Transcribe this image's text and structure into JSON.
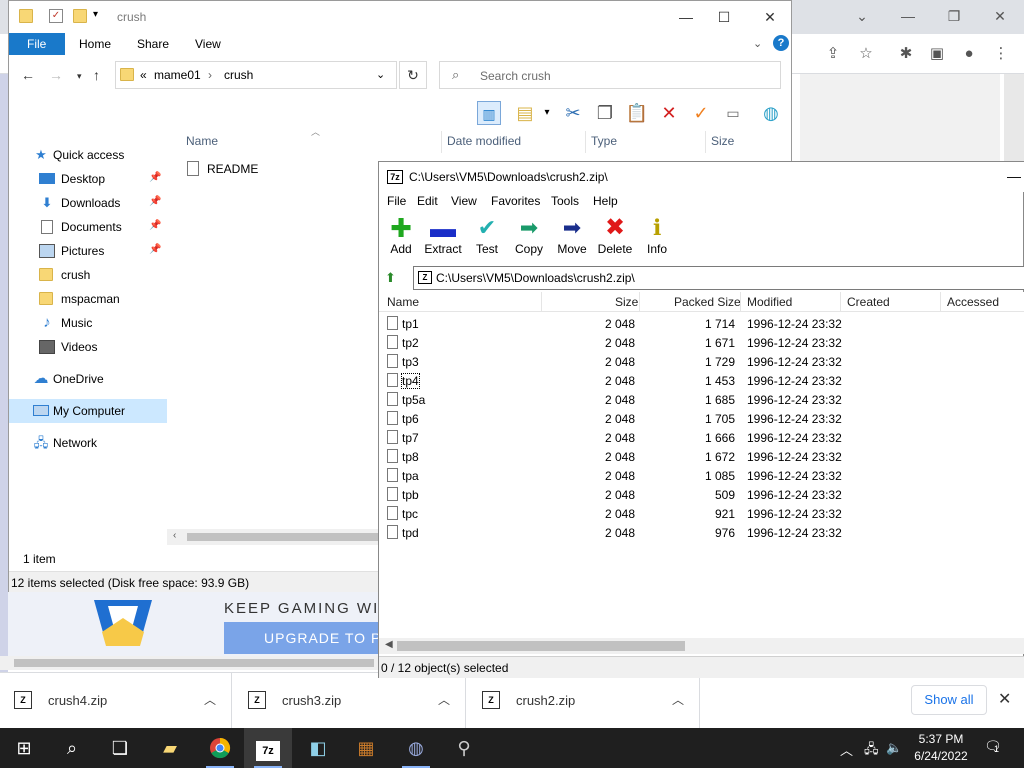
{
  "explorer": {
    "title": "crush",
    "ribbon_tabs": [
      "File",
      "Home",
      "Share",
      "View"
    ],
    "breadcrumb": [
      "mame01",
      "crush"
    ],
    "breadcrumb_prefix": "«",
    "search_placeholder": "Search crush",
    "nav": {
      "quick_access": "Quick access",
      "items": [
        {
          "label": "Desktop",
          "pinned": true
        },
        {
          "label": "Downloads",
          "pinned": true
        },
        {
          "label": "Documents",
          "pinned": true
        },
        {
          "label": "Pictures",
          "pinned": true
        },
        {
          "label": "crush",
          "pinned": false
        },
        {
          "label": "mspacman",
          "pinned": false
        },
        {
          "label": "Music",
          "pinned": false
        },
        {
          "label": "Videos",
          "pinned": false
        }
      ],
      "onedrive": "OneDrive",
      "my_computer": "My Computer",
      "network": "Network"
    },
    "columns": [
      "Name",
      "Date modified",
      "Type",
      "Size"
    ],
    "files": [
      "README"
    ],
    "item_count": "1 item",
    "status": "12 items selected (Disk free space: 93.9 GB)"
  },
  "sevenzip": {
    "title": "C:\\Users\\VM5\\Downloads\\crush2.zip\\",
    "menu": [
      "File",
      "Edit",
      "View",
      "Favorites",
      "Tools",
      "Help"
    ],
    "tools": [
      "Add",
      "Extract",
      "Test",
      "Copy",
      "Move",
      "Delete",
      "Info"
    ],
    "address": "C:\\Users\\VM5\\Downloads\\crush2.zip\\",
    "columns": [
      "Name",
      "Size",
      "Packed Size",
      "Modified",
      "Created",
      "Accessed"
    ],
    "rows": [
      {
        "name": "tp1",
        "size": "2 048",
        "packed": "1 714",
        "modified": "1996-12-24 23:32"
      },
      {
        "name": "tp2",
        "size": "2 048",
        "packed": "1 671",
        "modified": "1996-12-24 23:32"
      },
      {
        "name": "tp3",
        "size": "2 048",
        "packed": "1 729",
        "modified": "1996-12-24 23:32"
      },
      {
        "name": "tp4",
        "size": "2 048",
        "packed": "1 453",
        "modified": "1996-12-24 23:32"
      },
      {
        "name": "tp5a",
        "size": "2 048",
        "packed": "1 685",
        "modified": "1996-12-24 23:32"
      },
      {
        "name": "tp6",
        "size": "2 048",
        "packed": "1 705",
        "modified": "1996-12-24 23:32"
      },
      {
        "name": "tp7",
        "size": "2 048",
        "packed": "1 666",
        "modified": "1996-12-24 23:32"
      },
      {
        "name": "tp8",
        "size": "2 048",
        "packed": "1 672",
        "modified": "1996-12-24 23:32"
      },
      {
        "name": "tpa",
        "size": "2 048",
        "packed": "1 085",
        "modified": "1996-12-24 23:32"
      },
      {
        "name": "tpb",
        "size": "2 048",
        "packed": "509",
        "modified": "1996-12-24 23:32"
      },
      {
        "name": "tpc",
        "size": "2 048",
        "packed": "921",
        "modified": "1996-12-24 23:32"
      },
      {
        "name": "tpd",
        "size": "2 048",
        "packed": "976",
        "modified": "1996-12-24 23:32"
      }
    ],
    "status": "0 / 12 object(s) selected"
  },
  "chrome": {
    "ad_text": "KEEP GAMING WI",
    "ad_button": "UPGRADE TO P"
  },
  "downloads": {
    "items": [
      "crush4.zip",
      "crush3.zip",
      "crush2.zip"
    ],
    "show_all": "Show all"
  },
  "taskbar": {
    "time": "5:37 PM",
    "date": "6/24/2022",
    "notification_count": "1"
  },
  "colors": {
    "file_tab": "#1979ca",
    "selected_nav": "#cce8ff",
    "taskbar": "#1f1f1f",
    "chrome_link": "#1a73e8"
  }
}
